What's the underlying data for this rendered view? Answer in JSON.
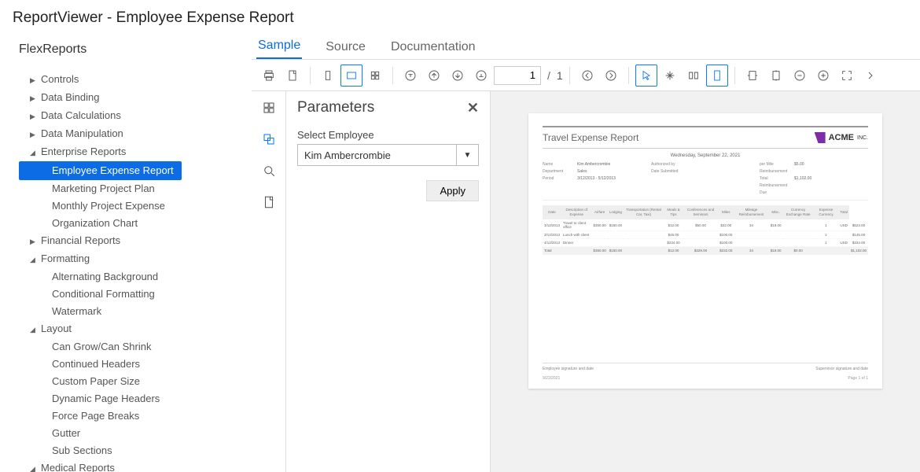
{
  "app_title": "ReportViewer - Employee Expense Report",
  "brand": "FlexReports",
  "tabs": {
    "sample": "Sample",
    "source": "Source",
    "docs": "Documentation"
  },
  "paging": {
    "current": "1",
    "total": "1"
  },
  "tree": [
    {
      "label": "Controls",
      "level": 0,
      "expanded": false,
      "leaf": false
    },
    {
      "label": "Data Binding",
      "level": 0,
      "expanded": false,
      "leaf": false
    },
    {
      "label": "Data Calculations",
      "level": 0,
      "expanded": false,
      "leaf": false
    },
    {
      "label": "Data Manipulation",
      "level": 0,
      "expanded": false,
      "leaf": false
    },
    {
      "label": "Enterprise Reports",
      "level": 0,
      "expanded": true,
      "leaf": false
    },
    {
      "label": "Employee Expense Report",
      "level": 1,
      "leaf": true,
      "selected": true
    },
    {
      "label": "Marketing Project Plan",
      "level": 1,
      "leaf": true
    },
    {
      "label": "Monthly Project Expense",
      "level": 1,
      "leaf": true
    },
    {
      "label": "Organization Chart",
      "level": 1,
      "leaf": true
    },
    {
      "label": "Financial Reports",
      "level": 0,
      "expanded": false,
      "leaf": false
    },
    {
      "label": "Formatting",
      "level": 0,
      "expanded": true,
      "leaf": false
    },
    {
      "label": "Alternating Background",
      "level": 1,
      "leaf": true
    },
    {
      "label": "Conditional Formatting",
      "level": 1,
      "leaf": true
    },
    {
      "label": "Watermark",
      "level": 1,
      "leaf": true
    },
    {
      "label": "Layout",
      "level": 0,
      "expanded": true,
      "leaf": false
    },
    {
      "label": "Can Grow/Can Shrink",
      "level": 1,
      "leaf": true
    },
    {
      "label": "Continued Headers",
      "level": 1,
      "leaf": true
    },
    {
      "label": "Custom Paper Size",
      "level": 1,
      "leaf": true
    },
    {
      "label": "Dynamic Page Headers",
      "level": 1,
      "leaf": true
    },
    {
      "label": "Force Page Breaks",
      "level": 1,
      "leaf": true
    },
    {
      "label": "Gutter",
      "level": 1,
      "leaf": true
    },
    {
      "label": "Sub Sections",
      "level": 1,
      "leaf": true
    },
    {
      "label": "Medical Reports",
      "level": 0,
      "expanded": true,
      "leaf": false
    }
  ],
  "parameters": {
    "title": "Parameters",
    "label": "Select Employee",
    "value": "Kim Ambercrombie",
    "apply": "Apply"
  },
  "report": {
    "title": "Travel Expense Report",
    "date": "Wednesday, September 22, 2021",
    "logo": "ACME",
    "logo_suffix": "INC.",
    "info_left": [
      {
        "k": "Name",
        "v": "Kim Ambercrombie"
      },
      {
        "k": "Department",
        "v": "Sales"
      },
      {
        "k": "Period",
        "v": "3/12/2013 - 5/12/2013"
      }
    ],
    "info_mid": [
      {
        "k": "Authorized by",
        "v": ""
      },
      {
        "k": "Date Submitted",
        "v": ""
      }
    ],
    "info_right": [
      {
        "k": "per Mile Reimbursement",
        "v": "$5.00"
      },
      {
        "k": "Total Reimbursement Due",
        "v": "$1,102.00"
      }
    ],
    "columns": [
      "Date",
      "Description of Expense",
      "Airfare",
      "Lodging",
      "Transportation (Rental Car, Taxi)",
      "Meals & Tips",
      "Conferences and Seminars",
      "Miles",
      "Mileage Reimbursement",
      "Misc.",
      "Currency Exchange Rate",
      "Expense Currency",
      "Total"
    ],
    "rows": [
      {
        "c": [
          "3/12/2013",
          "Travel to client office",
          "$350.00",
          "$150.00",
          "",
          "$12.00",
          "$50.00",
          "$32.00",
          "34",
          "$19.00",
          "",
          "1",
          "USD",
          "$623.00"
        ]
      },
      {
        "c": [
          "3/12/2013",
          "Lunch with client",
          "",
          "",
          "",
          "$45.00",
          "",
          "$100.00",
          "",
          "",
          "",
          "1",
          "",
          "$145.00"
        ]
      },
      {
        "c": [
          "4/12/2013",
          "Dinner",
          "",
          "",
          "",
          "$234.00",
          "",
          "$100.00",
          "",
          "",
          "",
          "1",
          "USD",
          "$334.00"
        ]
      }
    ],
    "total_row": [
      "Total",
      "",
      "$350.00",
      "$150.00",
      "",
      "$12.00",
      "$329.00",
      "$232.00",
      "34",
      "$19.00",
      "$0.00",
      "",
      "",
      "$1,102.00"
    ],
    "sig_left": "Employee signature and date",
    "sig_right": "Supervisor signature and date",
    "footer_left": "9/22/2021",
    "footer_right": "Page 1 of 1"
  }
}
